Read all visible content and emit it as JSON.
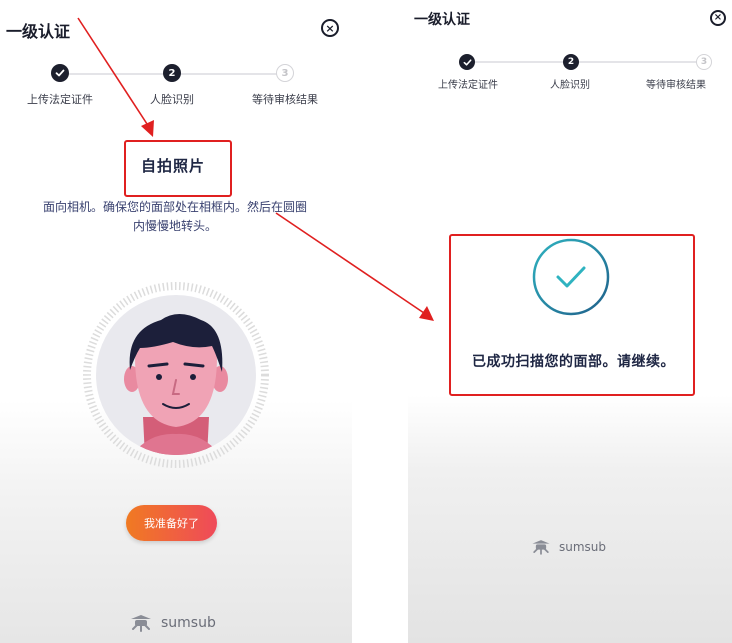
{
  "left_screen": {
    "title": "一级认证",
    "close_icon": "close-circle-icon",
    "steps": [
      {
        "number": "1",
        "label": "上传法定证件",
        "state": "completed"
      },
      {
        "number": "2",
        "label": "人脸识别",
        "state": "current"
      },
      {
        "number": "3",
        "label": "等待审核结果",
        "state": "pending"
      }
    ],
    "selfie_title": "自拍照片",
    "instructions": "面向相机。确保您的面部处在相框内。然后在圆圈内慢慢地转头。",
    "ready_button": "我准备好了",
    "brand": "sumsub"
  },
  "right_screen": {
    "title": "一级认证",
    "close_icon": "close-circle-icon",
    "steps": [
      {
        "number": "1",
        "label": "上传法定证件",
        "state": "completed"
      },
      {
        "number": "2",
        "label": "人脸识别",
        "state": "current"
      },
      {
        "number": "3",
        "label": "等待审核结果",
        "state": "pending"
      }
    ],
    "success_message": "已成功扫描您的面部。请继续。",
    "brand": "sumsub"
  },
  "colors": {
    "annotation_red": "#e02020",
    "success_teal": "#2fb3c0",
    "button_orange": "#f07a22",
    "button_pink": "#ef4a5a",
    "step_active": "#1c1f2d"
  }
}
